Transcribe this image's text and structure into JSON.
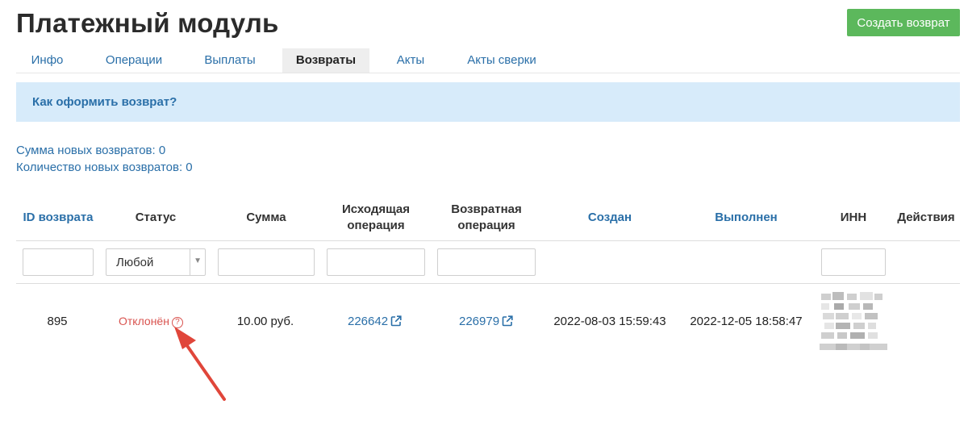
{
  "page": {
    "title": "Платежный модуль"
  },
  "actions": {
    "create_label": "Создать возврат"
  },
  "tabs": [
    {
      "label": "Инфо"
    },
    {
      "label": "Операции"
    },
    {
      "label": "Выплаты"
    },
    {
      "label": "Возвраты",
      "active": true
    },
    {
      "label": "Акты"
    },
    {
      "label": "Акты сверки"
    }
  ],
  "info": {
    "link_label": "Как оформить возврат?"
  },
  "stats": {
    "sum_new": "Сумма новых возвратов: 0",
    "count_new": "Количество новых возвратов: 0"
  },
  "table": {
    "headers": {
      "id": "ID возврата",
      "status": "Статус",
      "amount": "Сумма",
      "source_op_1": "Исходящая",
      "source_op_2": "операция",
      "return_op_1": "Возвратная",
      "return_op_2": "операция",
      "created": "Создан",
      "done": "Выполнен",
      "inn": "ИНН",
      "actions": "Действия"
    },
    "filters": {
      "status_selected": "Любой"
    },
    "rows": [
      {
        "id": "895",
        "status": "Отклонён",
        "amount": "10.00 руб.",
        "source_op": "226642",
        "return_op": "226979",
        "created": "2022-08-03 15:59:43",
        "done": "2022-12-05 18:58:47"
      }
    ]
  },
  "icons": {
    "help": "question-circle-icon",
    "external": "external-link-icon",
    "dropdown": "caret-down-icon"
  },
  "colors": {
    "accent": "#2a6fa8",
    "button": "#5cb85c",
    "info_bg": "#d7ebfa",
    "status_rejected": "#d9534f",
    "annotation_arrow": "#e0463a"
  }
}
